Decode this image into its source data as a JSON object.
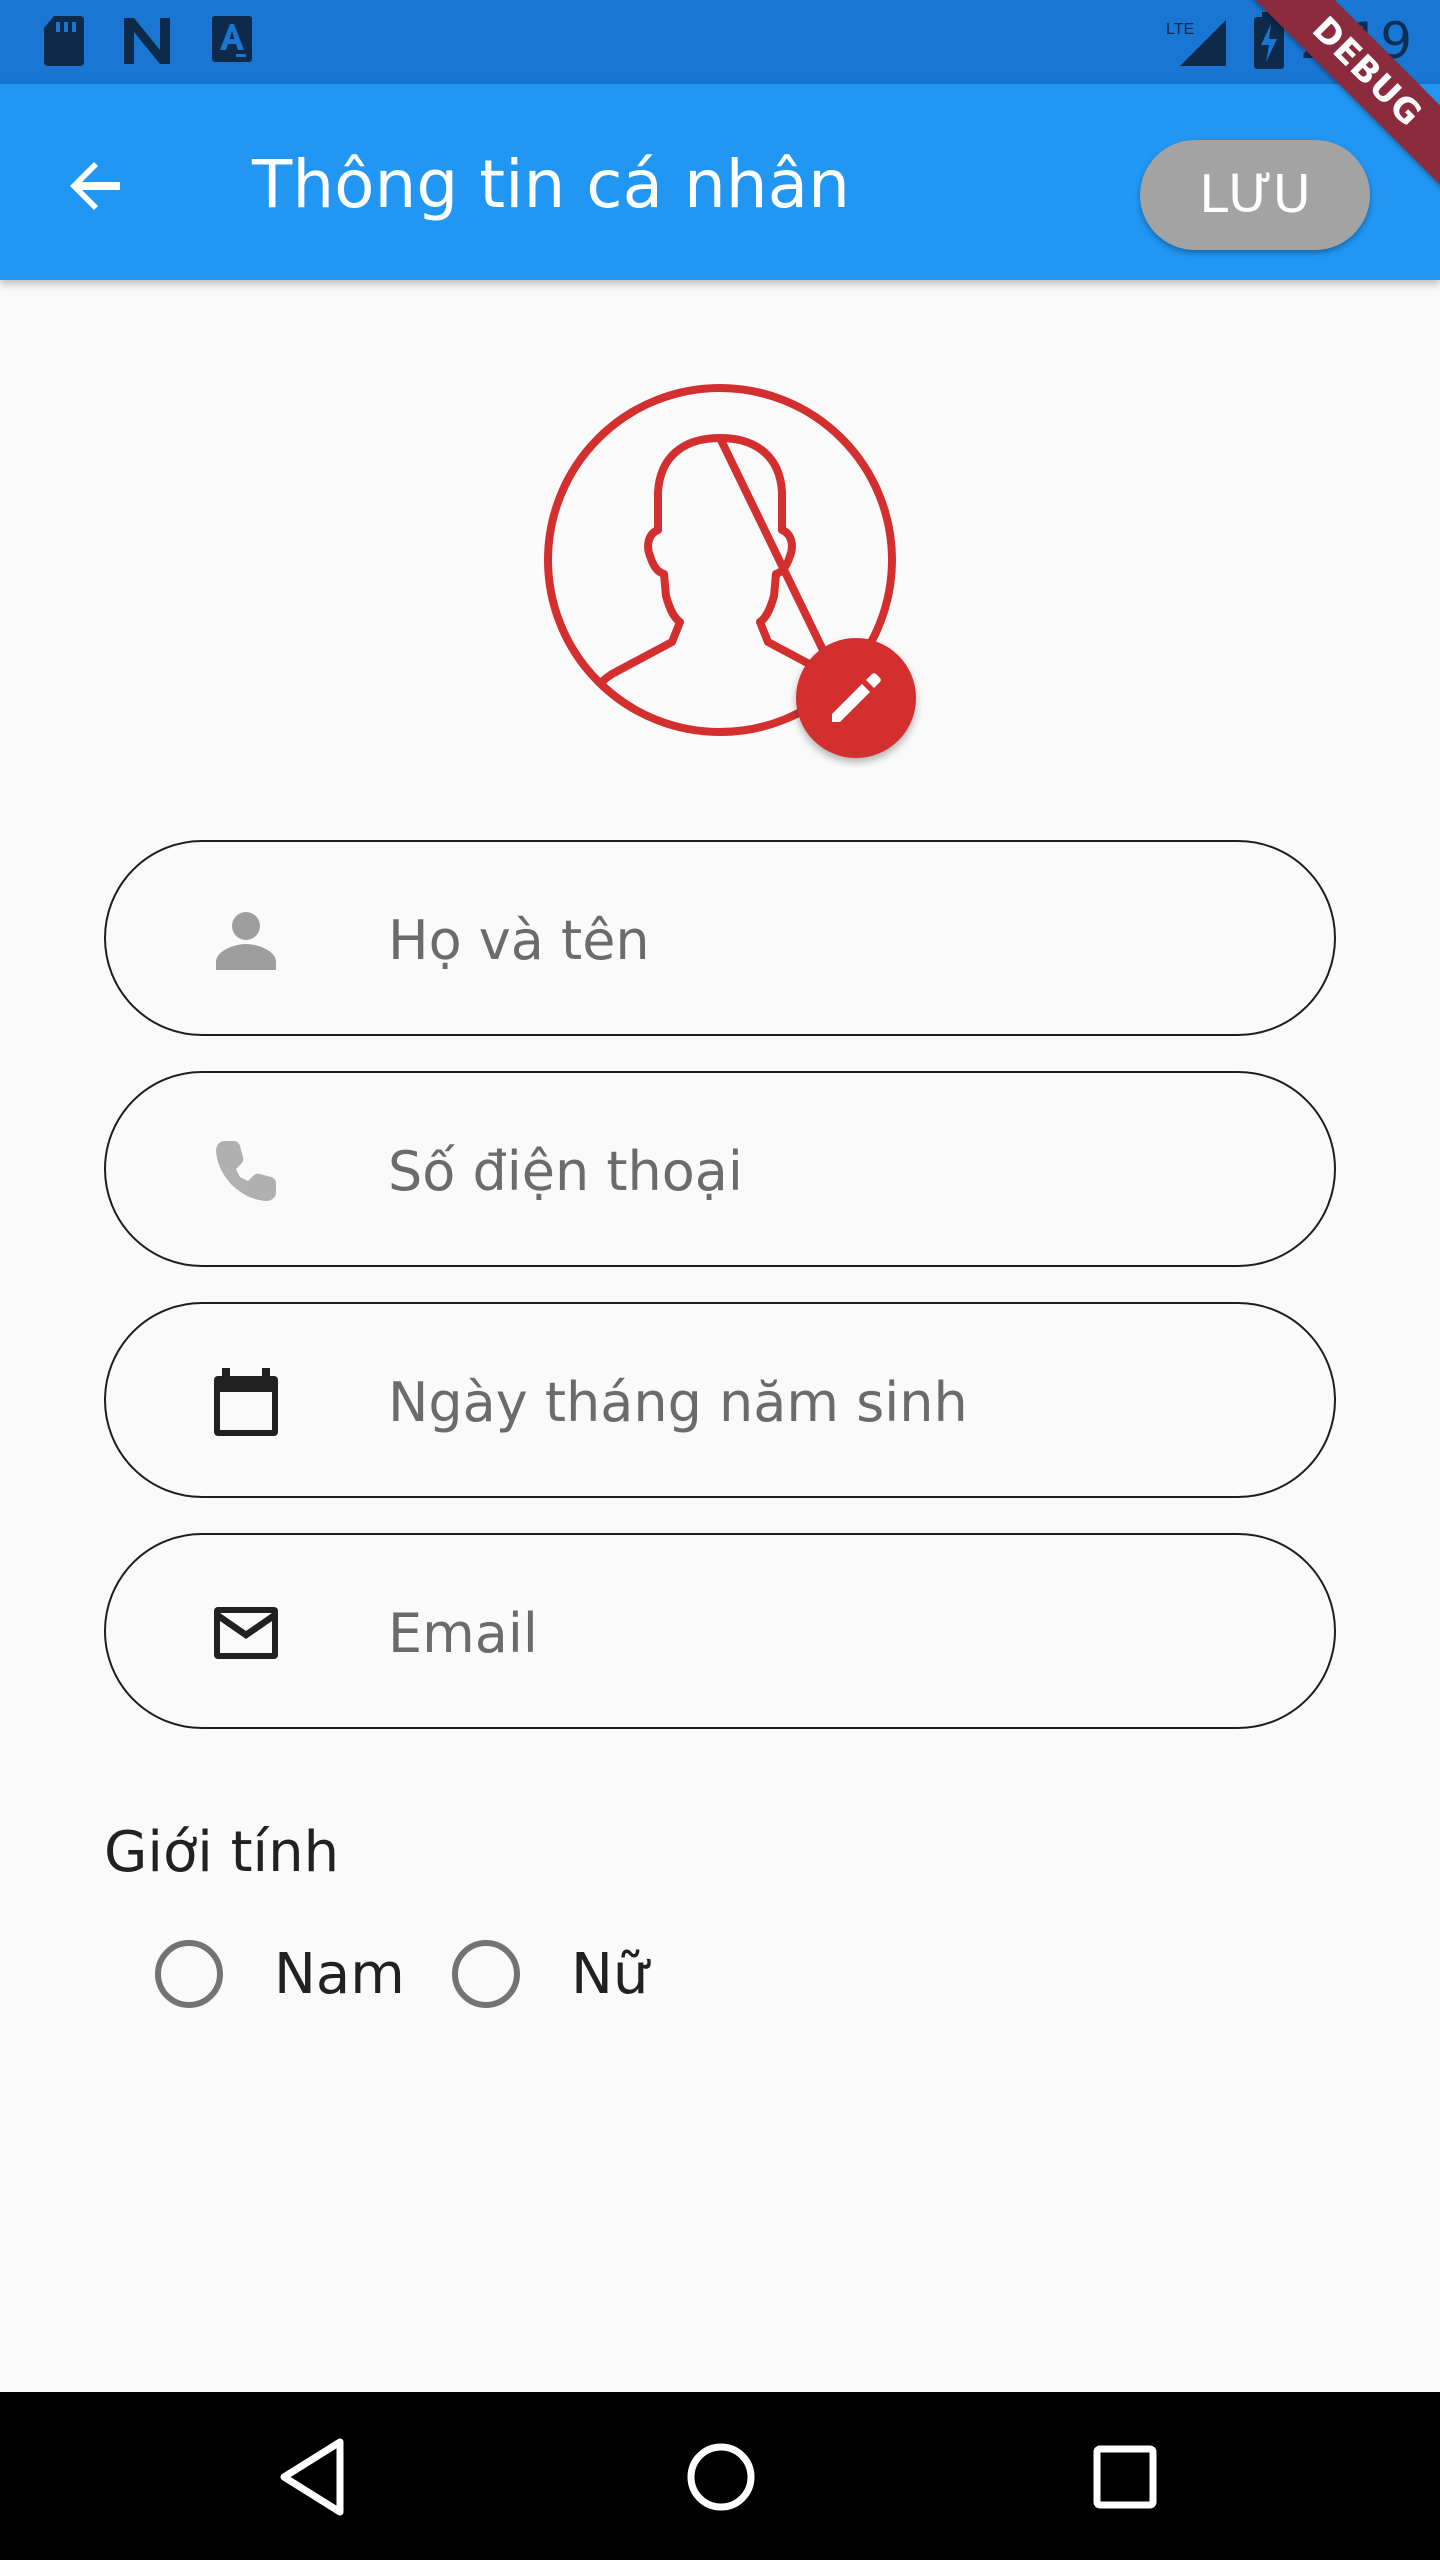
{
  "status_bar": {
    "time": "2:19",
    "network": "LTE",
    "left_icons": [
      "sd-card-icon",
      "n-app-icon",
      "a-app-icon"
    ]
  },
  "debug_banner": "DEBUG",
  "app_bar": {
    "title": "Thông tin cá nhân",
    "save_label": "LƯU",
    "accent_color": "#2196f3"
  },
  "avatar": {
    "icon": "user-avatar-icon",
    "color": "#d32f2f",
    "edit_icon": "pencil-icon"
  },
  "form": {
    "full_name": {
      "placeholder": "Họ và tên",
      "value": "",
      "icon": "person-icon"
    },
    "phone": {
      "placeholder": "Số điện thoại",
      "value": "",
      "icon": "phone-icon"
    },
    "birthday": {
      "placeholder": "Ngày tháng năm sinh",
      "value": "",
      "icon": "calendar-icon"
    },
    "email": {
      "placeholder": "Email",
      "value": "",
      "icon": "mail-icon"
    }
  },
  "gender": {
    "label": "Giới tính",
    "options": [
      {
        "label": "Nam",
        "selected": false
      },
      {
        "label": "Nữ",
        "selected": false
      }
    ]
  },
  "nav_bar": [
    "back-triangle-icon",
    "home-circle-icon",
    "recents-square-icon"
  ]
}
